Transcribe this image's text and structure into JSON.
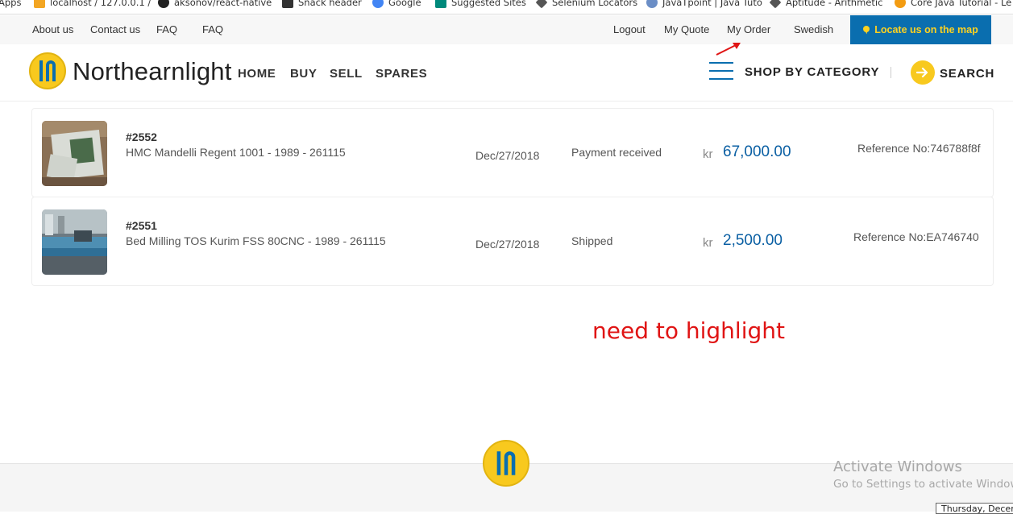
{
  "bookmarks": [
    {
      "label": "Apps",
      "icon": "apps-grid-icon"
    },
    {
      "label": "localhost / 127.0.0.1 /",
      "icon": "phpmyadmin-icon"
    },
    {
      "label": "aksonov/react-native",
      "icon": "github-icon"
    },
    {
      "label": "Snack header",
      "icon": "snack-icon"
    },
    {
      "label": "Google",
      "icon": "google-icon"
    },
    {
      "label": "Suggested Sites",
      "icon": "bing-icon"
    },
    {
      "label": "Selenium Locators",
      "icon": "diamond-icon"
    },
    {
      "label": "JavaTpoint | Java Tuto",
      "icon": "javatpoint-icon"
    },
    {
      "label": "Aptitude - Arithmetic",
      "icon": "diamond-icon"
    },
    {
      "label": "Core Java Tutorial - Le",
      "icon": "fire-icon"
    }
  ],
  "topbar": {
    "about": "About us",
    "contact": "Contact us",
    "faq1": "FAQ",
    "faq2": "FAQ",
    "logout": "Logout",
    "quote": "My Quote",
    "order": "My Order",
    "language": "Swedish",
    "locate": "Locate us on the map"
  },
  "header": {
    "brand": "Northearnlight",
    "nav": [
      "HOME",
      "BUY",
      "SELL",
      "SPARES"
    ],
    "shop_by_category": "SHOP BY CATEGORY",
    "search": "SEARCH"
  },
  "orders": [
    {
      "number": "#2552",
      "name": "HMC Mandelli Regent 1001 - 1989 - 261115",
      "date": "Dec/27/2018",
      "status": "Payment received",
      "currency": "kr",
      "amount": "67,000.00",
      "reference": "Reference No:746788f8f"
    },
    {
      "number": "#2551",
      "name": "Bed Milling TOS Kurim FSS 80CNC - 1989 - 261115",
      "date": "Dec/27/2018",
      "status": "Shipped",
      "currency": "kr",
      "amount": "2,500.00",
      "reference": "Reference No:EA746740"
    }
  ],
  "annotation": {
    "text": "need to highlight",
    "color": "#e01414"
  },
  "windows": {
    "activate_title": "Activate Windows",
    "activate_sub": "Go to Settings to activate Windows.",
    "tooltip": "Thursday, December"
  },
  "colors": {
    "brand_blue": "#0a6eaf",
    "brand_yellow": "#f8c91e",
    "price_blue": "#0a5fa3"
  }
}
